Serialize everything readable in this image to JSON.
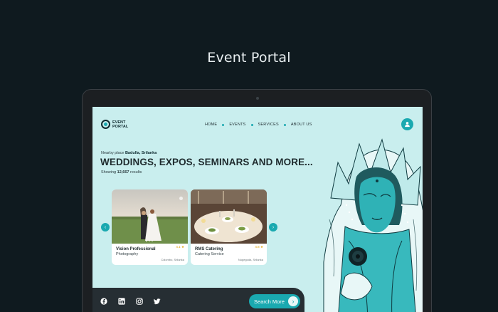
{
  "showcase": {
    "title": "Event Portal"
  },
  "nav": {
    "logo_text": "EVENT PORTAL",
    "menu": [
      {
        "label": "HOME"
      },
      {
        "label": "EVENTS"
      },
      {
        "label": "SERVICES"
      },
      {
        "label": "ABOUT US"
      }
    ],
    "profile_icon": "user-icon"
  },
  "hero": {
    "nearby_prefix": "Nearby place",
    "nearby_place": "Badulla, Srilanka",
    "headline": "WEDDINGS, EXPOS, SEMINARS AND MORE...",
    "results_prefix": "Showing",
    "results_count": "12,667",
    "results_suffix": "results"
  },
  "cards": [
    {
      "name": "Vision Professional",
      "category": "Photography",
      "rating": "4.1",
      "location": "Colombo, Srilanka"
    },
    {
      "name": "RMS Catering",
      "category": "Catering Service",
      "rating": "4.8",
      "location": "Nugegoda, Srilanka"
    }
  ],
  "footer": {
    "socials": [
      "facebook-icon",
      "linkedin-icon",
      "instagram-icon",
      "twitter-icon"
    ],
    "search_label": "Search More"
  },
  "colors": {
    "accent": "#1aa9b0",
    "background": "#c9eeee",
    "dark": "#262e33",
    "page": "#0f1a1f"
  }
}
